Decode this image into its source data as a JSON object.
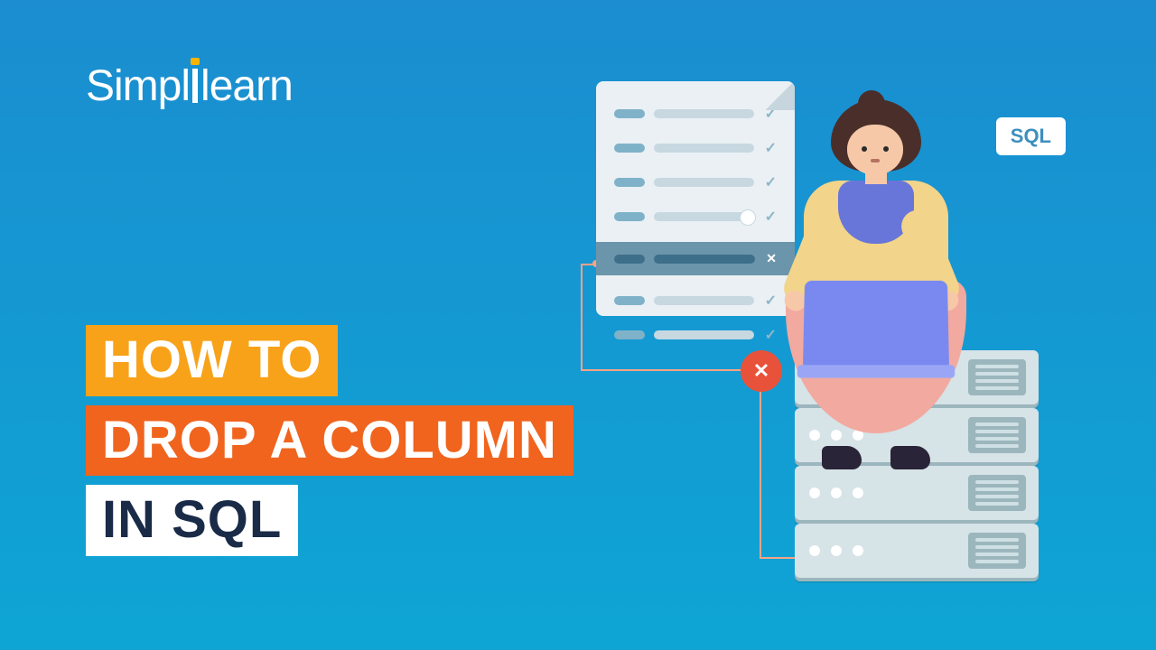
{
  "brand": {
    "name_part1": "Simpl",
    "name_part2": "learn"
  },
  "title": {
    "line1": "HOW TO",
    "line2": "DROP A COLUMN",
    "line3": "IN SQL"
  },
  "badge": {
    "label": "SQL"
  },
  "illustration": {
    "delete_icon": "✕",
    "doc_rows": [
      {
        "checked": true
      },
      {
        "checked": true
      },
      {
        "checked": true
      },
      {
        "checked": true
      },
      {
        "checked": false,
        "selected": true
      },
      {
        "checked": true
      },
      {
        "checked": true
      }
    ],
    "server_leds": 3,
    "server_slots": 4,
    "server_count": 4
  }
}
